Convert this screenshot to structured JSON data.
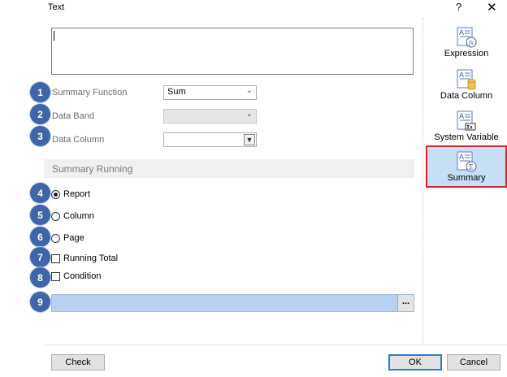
{
  "window": {
    "title": "Text",
    "help_glyph": "?",
    "close_glyph": "✕"
  },
  "expression_box": {
    "value": ""
  },
  "badges": [
    "1",
    "2",
    "3",
    "4",
    "5",
    "6",
    "7",
    "8",
    "9"
  ],
  "fields": {
    "summary_function": {
      "label": "Summary Function",
      "value": "Sum"
    },
    "data_band": {
      "label": "Data Band",
      "value": ""
    },
    "data_column": {
      "label": "Data Column",
      "value": ""
    }
  },
  "summary_running": {
    "header": "Summary Running",
    "options": [
      {
        "label": "Report",
        "checked": true
      },
      {
        "label": "Column",
        "checked": false
      },
      {
        "label": "Page",
        "checked": false
      }
    ]
  },
  "checkboxes": {
    "running_total": {
      "label": "Running Total",
      "checked": false
    },
    "condition": {
      "label": "Condition",
      "checked": false
    }
  },
  "condition_ellipsis": "...",
  "side_panel": {
    "items": [
      {
        "label": "Expression",
        "icon": "expression-icon",
        "selected": false
      },
      {
        "label": "Data Column",
        "icon": "data-column-icon",
        "selected": false
      },
      {
        "label": "System Variable",
        "icon": "system-variable-icon",
        "selected": false
      },
      {
        "label": "Summary",
        "icon": "summary-icon",
        "selected": true
      }
    ]
  },
  "buttons": {
    "check": "Check",
    "ok": "OK",
    "cancel": "Cancel"
  },
  "colors": {
    "badge": "#3e65a8",
    "selected_bg": "#c7def7",
    "selected_border": "#d7262d",
    "condition_bar": "#b7d1ee",
    "default_button_border": "#2f7ad1"
  }
}
